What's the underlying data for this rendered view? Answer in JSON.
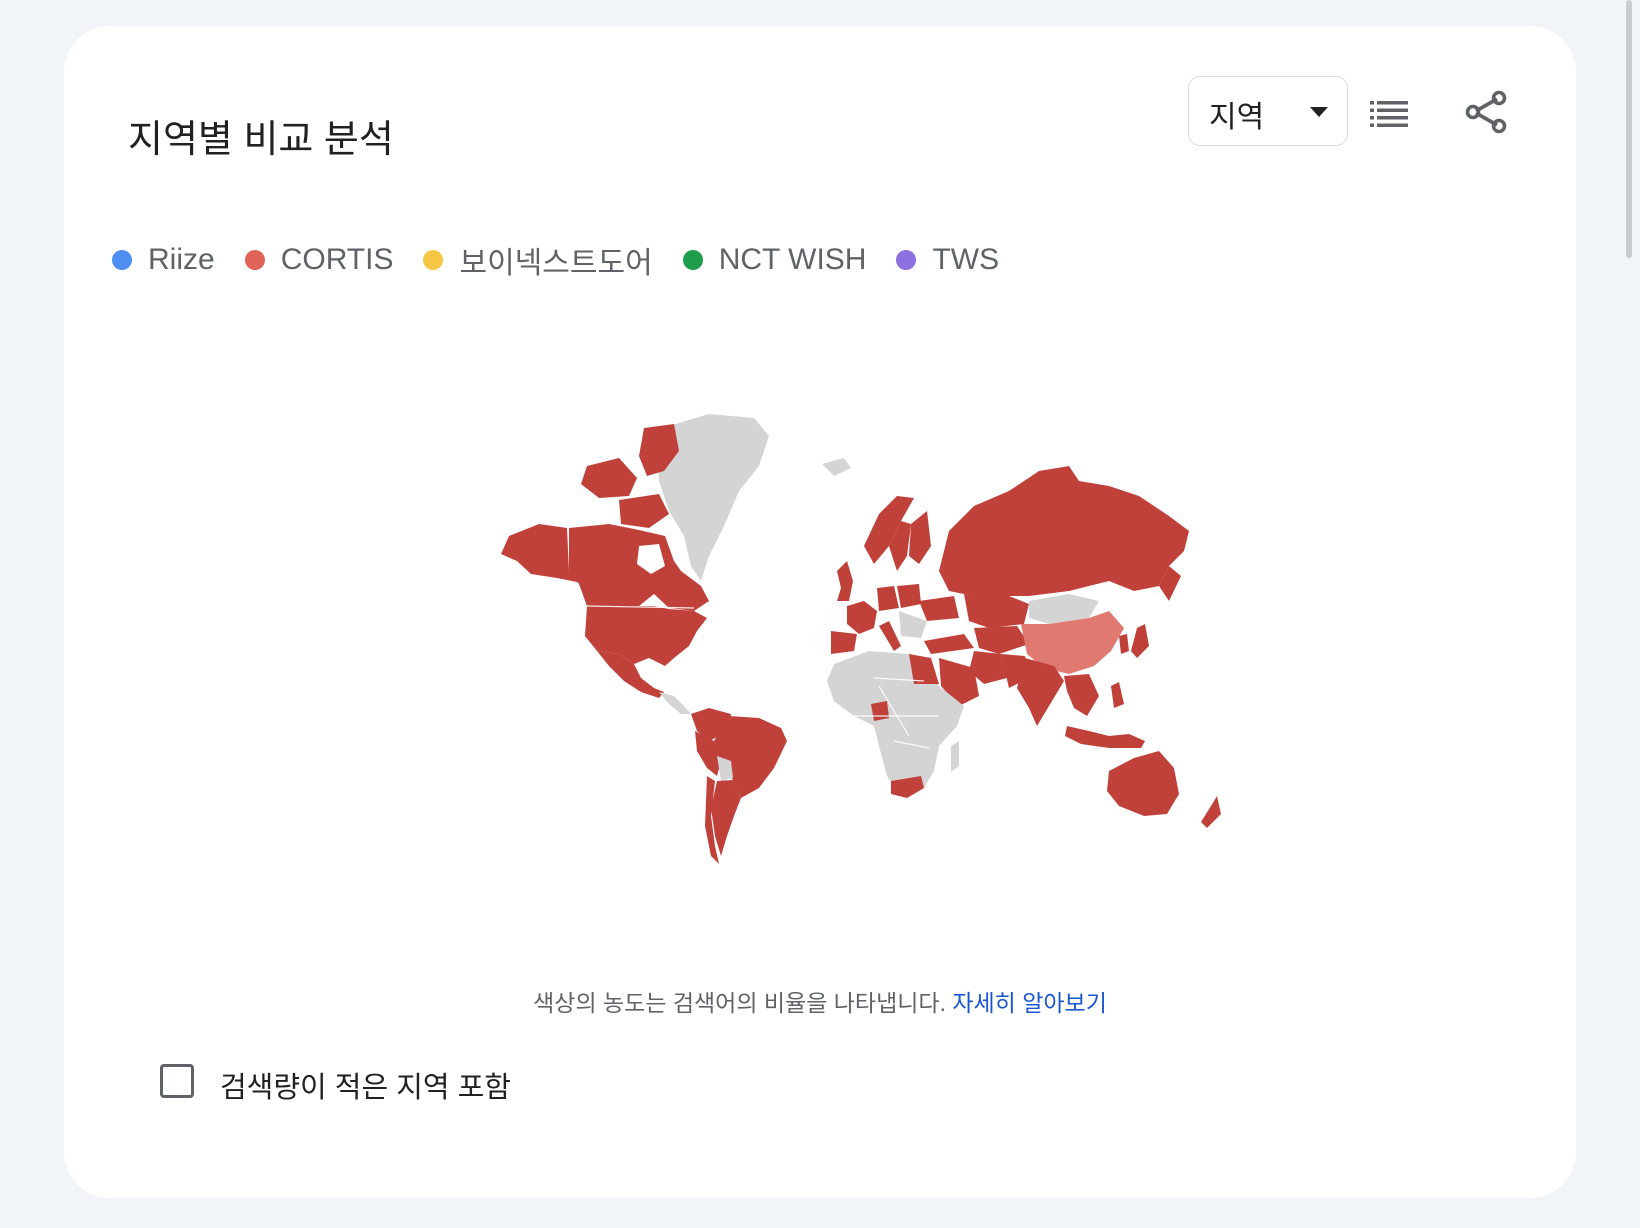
{
  "card": {
    "title": "지역별 비교 분석"
  },
  "toolbar": {
    "region_select_value": "지역",
    "list_icon": "list-view-icon",
    "share_icon": "share-icon"
  },
  "legend": [
    {
      "label": "Riize",
      "color": "#4d8ef0"
    },
    {
      "label": "CORTIS",
      "color": "#e06358"
    },
    {
      "label": "보이넥스트도어",
      "color": "#f6c744"
    },
    {
      "label": "NCT WISH",
      "color": "#1e9e4a"
    },
    {
      "label": "TWS",
      "color": "#8c6fe0"
    }
  ],
  "map": {
    "colors": {
      "no_data": "#d4d4d4",
      "dominant_strong": "#c0413a",
      "dominant_medium": "#d55b50",
      "dominant_light": "#e07a70"
    }
  },
  "footnote": {
    "text": "색상의 농도는 검색어의 비율을 나타냅니다.",
    "link": "자세히 알아보기"
  },
  "low_volume": {
    "label": "검색량이 적은 지역 포함",
    "checked": false
  }
}
